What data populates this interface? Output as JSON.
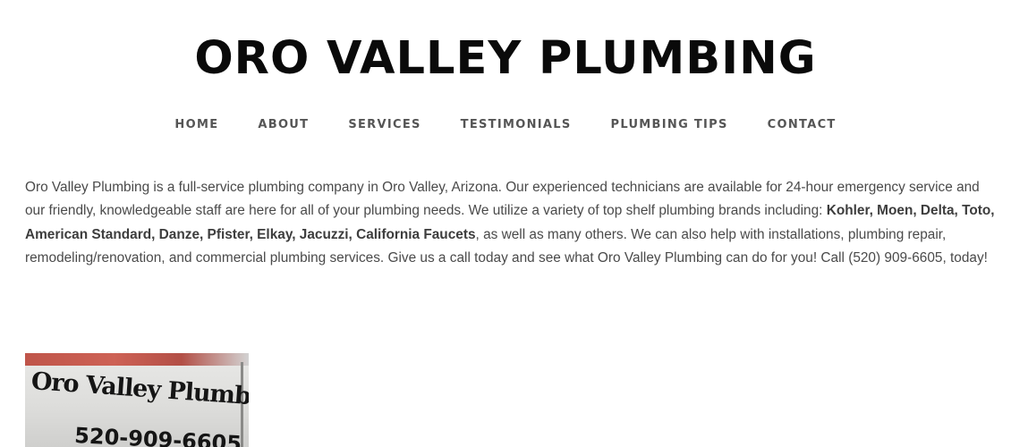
{
  "site": {
    "title": "ORO VALLEY PLUMBING"
  },
  "nav": {
    "items": [
      {
        "label": "HOME"
      },
      {
        "label": "ABOUT"
      },
      {
        "label": "SERVICES"
      },
      {
        "label": "TESTIMONIALS"
      },
      {
        "label": "PLUMBING TIPS"
      },
      {
        "label": "CONTACT"
      }
    ]
  },
  "intro": {
    "text_before": "Oro Valley Plumbing is a full-service plumbing company in Oro Valley, Arizona. Our experienced technicians are available for 24-hour emergency service and our friendly, knowledgeable staff are here for all of your plumbing needs. We utilize a variety of top shelf plumbing brands including: ",
    "brands": "Kohler, Moen, Delta, Toto, American Standard, Danze, Pfister, Elkay, Jacuzzi, California Faucets",
    "text_after": ", as well as many others. We can also help with installations, plumbing repair, remodeling/renovation, and commercial plumbing services. Give us a call today and see what Oro Valley Plumbing can do for you! Call (520) 909-6605, today!"
  },
  "photo": {
    "painted_name": "Oro Valley Plumbing",
    "painted_phone": "520-909-6605"
  }
}
